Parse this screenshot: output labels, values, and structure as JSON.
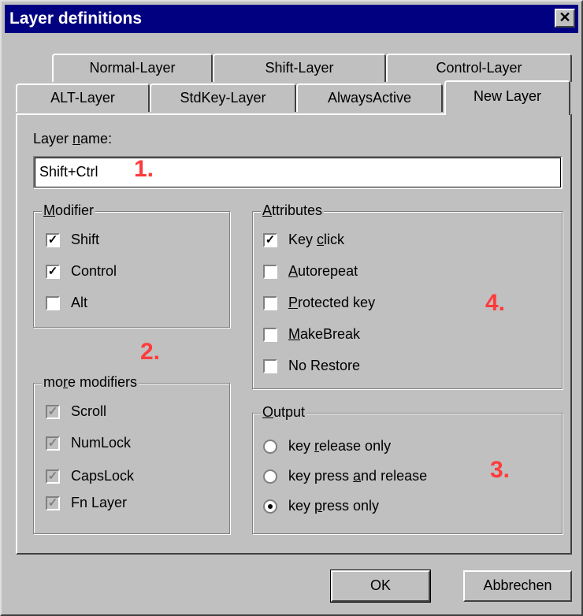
{
  "window": {
    "title": "Layer definitions",
    "close_glyph": "✕"
  },
  "tabs_row1": [
    "Normal-Layer",
    "Shift-Layer",
    "Control-Layer"
  ],
  "tabs_row2": [
    "ALT-Layer",
    "StdKey-Layer",
    "AlwaysActive",
    "New Layer"
  ],
  "active_tab": "New Layer",
  "layer_name": {
    "label": "Layer name:",
    "value": "Shift+Ctrl"
  },
  "modifier": {
    "label": "Modifier",
    "items": [
      {
        "label": "Shift",
        "checked": true
      },
      {
        "label": "Control",
        "checked": true
      },
      {
        "label": "Alt",
        "checked": false
      }
    ]
  },
  "more_modifiers": {
    "label": "more modifiers",
    "items": [
      {
        "label": "Scroll",
        "checked": true,
        "disabled": true
      },
      {
        "label": "NumLock",
        "checked": true,
        "disabled": true
      },
      {
        "label": "CapsLock",
        "checked": true,
        "disabled": true
      },
      {
        "label": "Fn Layer",
        "checked": true,
        "disabled": true
      }
    ]
  },
  "attributes": {
    "label": "Attributes",
    "items": [
      {
        "label": "Key click",
        "checked": true
      },
      {
        "label": "Autorepeat",
        "checked": false
      },
      {
        "label": "Protected key",
        "checked": false
      },
      {
        "label": "MakeBreak",
        "checked": false
      },
      {
        "label": "No Restore",
        "checked": false
      }
    ]
  },
  "output": {
    "label": "Output",
    "options": [
      "key release only",
      "key press and release",
      "key press only"
    ],
    "selected_index": 2
  },
  "annotations": [
    "1.",
    "2.",
    "3.",
    "4."
  ],
  "buttons": {
    "ok": "OK",
    "cancel": "Abbrechen"
  },
  "colors": {
    "titlebar": "#000080",
    "face": "#c0c0c0",
    "annotation": "#ff3b3b"
  }
}
